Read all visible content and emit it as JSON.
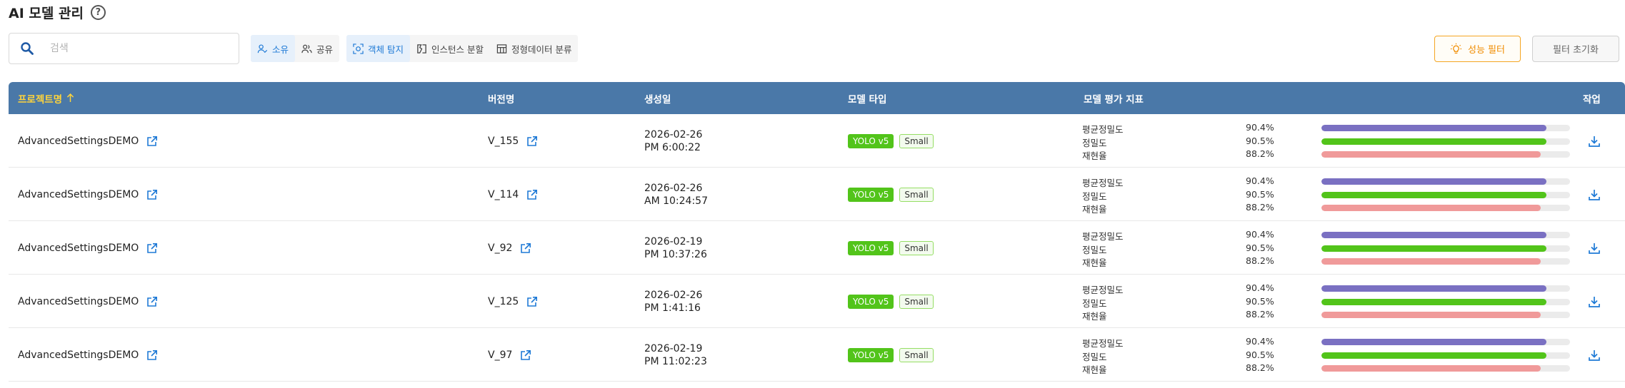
{
  "header": {
    "title": "AI 모델 관리",
    "help_icon": "?"
  },
  "search": {
    "placeholder": "검색",
    "value": ""
  },
  "ownership_filter": {
    "options": [
      {
        "label": "소유",
        "icon": "user-check-icon",
        "active": true
      },
      {
        "label": "공유",
        "icon": "users-icon",
        "active": false
      }
    ]
  },
  "task_filter": {
    "options": [
      {
        "label": "객체 탐지",
        "icon": "object-detection-icon",
        "active": true
      },
      {
        "label": "인스턴스 분할",
        "icon": "instance-segmentation-icon",
        "active": false
      },
      {
        "label": "정형데이터 분류",
        "icon": "table-icon",
        "active": false
      }
    ]
  },
  "buttons": {
    "performance_filter": "성능 필터",
    "reset_filter": "필터 초기화"
  },
  "colors": {
    "header_bg": "#4a78a8",
    "sorted_header": "#ffd43b",
    "accent_blue": "#1f7ad6",
    "yolo_tag": "#52c41a",
    "metric_map": "#7a70c2",
    "metric_precision": "#52c41a",
    "metric_recall": "#f09a9a",
    "performance_button": "#f5a623"
  },
  "table": {
    "columns": {
      "project": "프로젝트명",
      "version": "버전명",
      "created": "생성일",
      "model_type": "모델 타입",
      "metrics": "모델 평가 지표",
      "action": "작업"
    },
    "sort": {
      "column": "project",
      "direction": "asc",
      "icon": "arrow-up-icon"
    },
    "rows": [
      {
        "project": "AdvancedSettingsDEMO",
        "version": "V_155",
        "date": "2026-02-26",
        "time": "PM 6:00:22",
        "model": "YOLO v5",
        "size": "Small",
        "metrics": [
          {
            "label": "평균정밀도",
            "value": "90.4%"
          },
          {
            "label": "정밀도",
            "value": "90.5%"
          },
          {
            "label": "재현율",
            "value": "88.2%"
          }
        ]
      },
      {
        "project": "AdvancedSettingsDEMO",
        "version": "V_114",
        "date": "2026-02-26",
        "time": "AM 10:24:57",
        "model": "YOLO v5",
        "size": "Small",
        "metrics": [
          {
            "label": "평균정밀도",
            "value": "90.4%"
          },
          {
            "label": "정밀도",
            "value": "90.5%"
          },
          {
            "label": "재현율",
            "value": "88.2%"
          }
        ]
      },
      {
        "project": "AdvancedSettingsDEMO",
        "version": "V_92",
        "date": "2026-02-19",
        "time": "PM 10:37:26",
        "model": "YOLO v5",
        "size": "Small",
        "metrics": [
          {
            "label": "평균정밀도",
            "value": "90.4%"
          },
          {
            "label": "정밀도",
            "value": "90.5%"
          },
          {
            "label": "재현율",
            "value": "88.2%"
          }
        ]
      },
      {
        "project": "AdvancedSettingsDEMO",
        "version": "V_125",
        "date": "2026-02-26",
        "time": "PM 1:41:16",
        "model": "YOLO v5",
        "size": "Small",
        "metrics": [
          {
            "label": "평균정밀도",
            "value": "90.4%"
          },
          {
            "label": "정밀도",
            "value": "90.5%"
          },
          {
            "label": "재현율",
            "value": "88.2%"
          }
        ]
      },
      {
        "project": "AdvancedSettingsDEMO",
        "version": "V_97",
        "date": "2026-02-19",
        "time": "PM 11:02:23",
        "model": "YOLO v5",
        "size": "Small",
        "metrics": [
          {
            "label": "평균정밀도",
            "value": "90.4%"
          },
          {
            "label": "정밀도",
            "value": "90.5%"
          },
          {
            "label": "재현율",
            "value": "88.2%"
          }
        ]
      }
    ]
  }
}
